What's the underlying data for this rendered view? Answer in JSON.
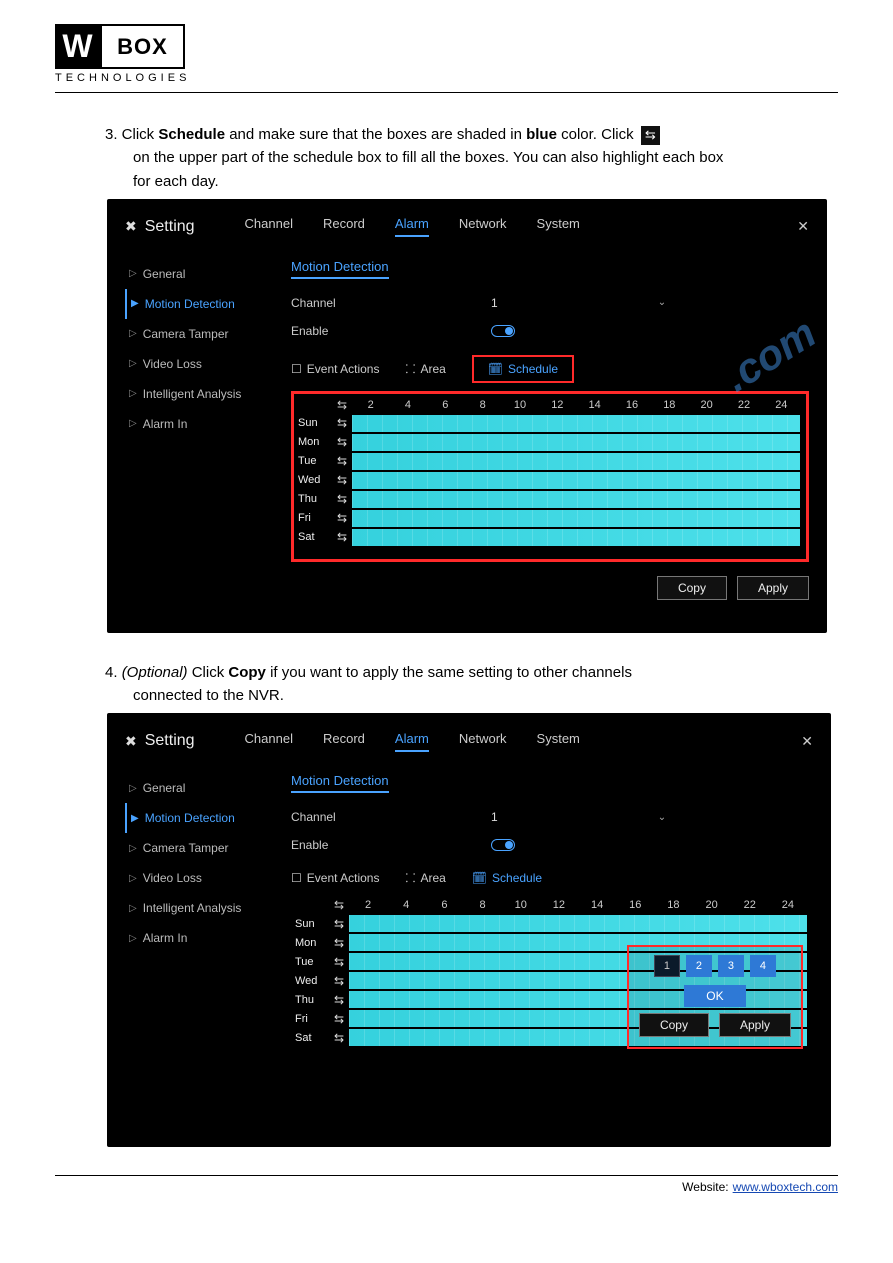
{
  "logo": {
    "w": "W",
    "box": "BOX",
    "sub": "TECHNOLOGIES"
  },
  "step3a": "3. Click",
  "step3b": "Schedule",
  "step3c": "and make sure that the boxes are shaded in",
  "step3d": "blue",
  "step3e": "color. Click",
  "step3f": "on the upper part of the schedule box to fill all the boxes. You can also highlight each box",
  "step3g": "for each day.",
  "step4a": "4.",
  "step4b": "(Optional)",
  "step4c": "Click",
  "step4d": "Copy",
  "step4e": "if you want to apply the same setting to other channels",
  "step4f": "connected to the NVR.",
  "swap_glyph": "⇆",
  "shot": {
    "title": "Setting",
    "gear": "✖",
    "close": "✕",
    "top_tabs": [
      "Channel",
      "Record",
      "Alarm",
      "Network",
      "System"
    ],
    "active_top": "Alarm",
    "sidebar": [
      "General",
      "Motion Detection",
      "Camera Tamper",
      "Video Loss",
      "Intelligent Analysis",
      "Alarm In"
    ],
    "active_side": "Motion Detection",
    "sub_tab": "Motion Detection",
    "channel_label": "Channel",
    "channel_val": "1",
    "enable_label": "Enable",
    "event_actions": "Event Actions",
    "area": "Area",
    "schedule": "Schedule",
    "hours": [
      "2",
      "4",
      "6",
      "8",
      "10",
      "12",
      "14",
      "16",
      "18",
      "20",
      "22",
      "24"
    ],
    "days": [
      "Sun",
      "Mon",
      "Tue",
      "Wed",
      "Thu",
      "Fri",
      "Sat"
    ],
    "copy_btn": "Copy",
    "apply_btn": "Apply",
    "copy_options": [
      "1",
      "2",
      "3",
      "4"
    ],
    "ok": "OK"
  },
  "footer": {
    "prefix": "Website:",
    "url_text": "www.wboxtech.com",
    "url": "www.wboxtech.com"
  }
}
